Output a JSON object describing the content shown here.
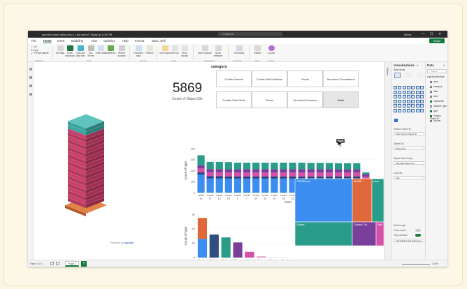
{
  "window": {
    "title": "speckle-tower-data-color • Last saved: Today at 1:06 PM",
    "search_placeholder": "Search",
    "user": "Mikes",
    "share_label": "Share"
  },
  "menu": [
    "File",
    "Home",
    "Insert",
    "Modeling",
    "View",
    "Optimize",
    "Help",
    "Format",
    "Data / Drill"
  ],
  "ribbon": {
    "clipboard": [
      "Cut",
      "Copy",
      "Format painter"
    ],
    "buttons": [
      "Get data",
      "Excel workbook",
      "OneLake data hub",
      "SQL Server",
      "Enter data",
      "Dataverse",
      "Recent sources",
      "Transform data",
      "Refresh",
      "New visual",
      "Text box",
      "More visuals",
      "New measure",
      "Quick measure",
      "Sensitivity",
      "Publish",
      "Copilot"
    ],
    "groups": [
      "Clipboard",
      "Data",
      "Queries",
      "Insert",
      "Calculations",
      "Sensitivity",
      "Share",
      "Copilot"
    ]
  },
  "kpi": {
    "value": "5869",
    "label": "Count of Object IDs"
  },
  "slicer": {
    "title": "category",
    "items": [
      "Curtain Panels",
      "Curtain Wall Mullions",
      "Roofs",
      "Structural Foundations",
      "Curtain Wall Grids",
      "Floors",
      "Structural Columns",
      "Walls"
    ],
    "selected": "Walls",
    "tooltip": "Walls"
  },
  "model": {
    "powered_by": "Powered by",
    "brand": "Speckle"
  },
  "colors": {
    "blue": "#3b8ef0",
    "orange": "#e0693c",
    "teal": "#2a9d8a",
    "purple": "#7a3f9a",
    "magenta": "#d64fa8",
    "darkteal": "#1f6f6b",
    "slate": "#2f4f7f"
  },
  "chart_data": [
    {
      "type": "bar",
      "title": "",
      "xlabel": "level",
      "ylabel": "Count of type",
      "ylim": [
        0,
        400
      ],
      "yticks": [
        "0",
        "100",
        "200",
        "300",
        "400"
      ],
      "categories": [
        "Level 11",
        "Level 17",
        "Level 12",
        "Level 16",
        "Level 5",
        "Level 7",
        "Level 14",
        "Level 13",
        "Level 10",
        "Level 18",
        "Level 15",
        "Level 3",
        "Level 19",
        "Level 6",
        "Level 9",
        "Level 2",
        "Level 8",
        "Level 4",
        "Level -1",
        "Level 1"
      ],
      "series": [
        {
          "name": "",
          "color": "#3b8ef0",
          "values": [
            165,
            130,
            130,
            128,
            128,
            128,
            128,
            128,
            128,
            128,
            128,
            128,
            128,
            128,
            128,
            128,
            128,
            128,
            100,
            12
          ]
        },
        {
          "name": "",
          "color": "#2a3f7a",
          "values": [
            20,
            20,
            20,
            20,
            20,
            20,
            20,
            20,
            20,
            20,
            20,
            20,
            20,
            20,
            20,
            20,
            20,
            20,
            15,
            0
          ]
        },
        {
          "name": "",
          "color": "#d64fa8",
          "values": [
            35,
            35,
            35,
            35,
            35,
            35,
            35,
            35,
            35,
            35,
            35,
            35,
            35,
            35,
            35,
            35,
            35,
            35,
            30,
            8
          ]
        },
        {
          "name": "",
          "color": "#7a3f9a",
          "values": [
            30,
            30,
            30,
            30,
            30,
            30,
            30,
            30,
            30,
            30,
            30,
            30,
            30,
            30,
            30,
            30,
            30,
            30,
            25,
            0
          ]
        },
        {
          "name": "",
          "color": "#2a9d8a",
          "values": [
            90,
            65,
            65,
            65,
            60,
            60,
            60,
            60,
            60,
            60,
            60,
            60,
            58,
            58,
            58,
            55,
            55,
            55,
            15,
            0
          ]
        }
      ]
    },
    {
      "type": "bar",
      "title": "",
      "xlabel": "category",
      "ylabel": "Count of type",
      "ylim": [
        0,
        3000
      ],
      "yticks": [
        "0",
        "1K",
        "2K",
        "3K"
      ],
      "categories": [
        "Curtain Wall Mullions",
        "Curtain Panels",
        "Curtain Wall Grids",
        "Struct. Colum...",
        "Walls",
        "Floors",
        "Struct. Found...",
        "Roofs"
      ],
      "series": [
        {
          "name": "",
          "color": "#3b8ef0",
          "values": [
            1300,
            0,
            0,
            0,
            0,
            0,
            0,
            0
          ]
        },
        {
          "name": "",
          "color": "#e0693c",
          "values": [
            1450,
            0,
            0,
            0,
            0,
            0,
            0,
            0
          ]
        },
        {
          "name": "",
          "color": "#2f4f7f",
          "values": [
            0,
            1600,
            0,
            0,
            0,
            0,
            0,
            0
          ]
        },
        {
          "name": "",
          "color": "#2a9d8a",
          "values": [
            0,
            0,
            1400,
            0,
            0,
            0,
            0,
            0
          ]
        },
        {
          "name": "",
          "color": "#7a3f9a",
          "values": [
            0,
            0,
            0,
            1050,
            0,
            0,
            0,
            0
          ]
        },
        {
          "name": "",
          "color": "#d64fa8",
          "values": [
            0,
            0,
            0,
            0,
            400,
            0,
            0,
            0
          ]
        },
        {
          "name": "",
          "color": "#e3a3cf",
          "values": [
            0,
            0,
            0,
            0,
            0,
            90,
            0,
            0
          ]
        },
        {
          "name": "",
          "color": "#cccccc",
          "values": [
            0,
            0,
            0,
            0,
            0,
            0,
            20,
            8
          ]
        }
      ]
    },
    {
      "type": "heatmap",
      "title": "treemap",
      "cells": [
        {
          "label": "735c55bnnn",
          "color": "#3b8ef0"
        },
        {
          "label": "b8cf55...",
          "color": "#e0693c"
        },
        {
          "label": "nnnn",
          "color": "#2a9d8a"
        },
        {
          "label": "Glazed",
          "color": "#2a9d8a"
        },
        {
          "label": "Circular-Col...",
          "color": "#7a3f9a"
        },
        {
          "label": "Wall",
          "color": "#d64fa8"
        }
      ]
    }
  ],
  "panes": {
    "visualizations": "Visualizations",
    "data": "Data",
    "filters": "Filters",
    "build_visual": "Build visual",
    "data_search": "Search",
    "data_table": "SpeckleData",
    "data_fields": [
      {
        "label": "area",
        "checked": false
      },
      {
        "label": "category",
        "checked": false
      },
      {
        "label": "data",
        "checked": false
      },
      {
        "label": "level",
        "checked": false
      },
      {
        "label": "Object IDs",
        "checked": true
      },
      {
        "label": "Speckle Type",
        "checked": false
      },
      {
        "label": "type",
        "checked": true
      },
      {
        "label": "Version Object ID",
        "checked": true
      },
      {
        "label": "volume",
        "checked": false
      }
    ],
    "wells": [
      {
        "label": "Version Object ID",
        "value": "First Version Object ID"
      },
      {
        "label": "Object IDs",
        "value": "Object IDs"
      },
      {
        "label": "Object Data Tooltip",
        "value": "Add data fields here"
      },
      {
        "label": "Color By",
        "value": "type"
      }
    ],
    "drill": {
      "title": "Drill through",
      "cross_report": "Cross-report",
      "keep_filters": "Keep all filters",
      "add": "Add drill-through fields here"
    }
  },
  "status": {
    "page_info": "Page 1 of 1",
    "page_tab": "Page 1",
    "zoom": "100%"
  }
}
